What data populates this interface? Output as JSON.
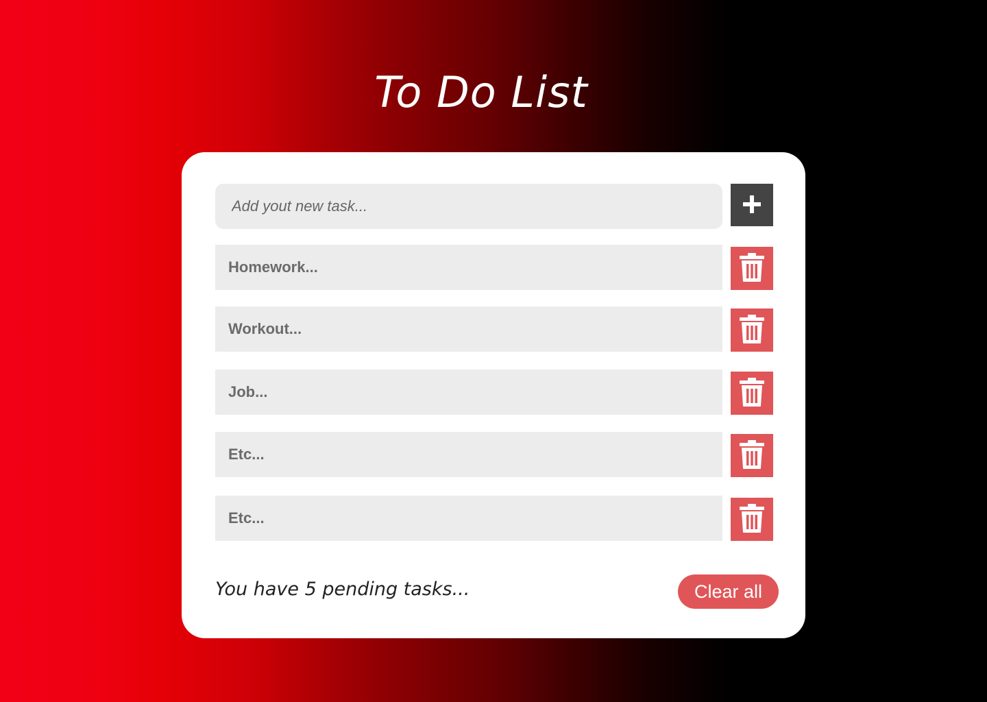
{
  "title": "To Do List",
  "input": {
    "placeholder": "Add yout new task...",
    "add_icon": "plus-icon"
  },
  "tasks": [
    {
      "label": "Homework...",
      "delete_icon": "trash-icon"
    },
    {
      "label": "Workout...",
      "delete_icon": "trash-icon"
    },
    {
      "label": "Job...",
      "delete_icon": "trash-icon"
    },
    {
      "label": "Etc...",
      "delete_icon": "trash-icon"
    },
    {
      "label": "Etc...",
      "delete_icon": "trash-icon"
    }
  ],
  "footer": {
    "pending_text": "You have 5 pending tasks...",
    "clear_label": "Clear all"
  },
  "colors": {
    "background_start": "#f20016",
    "background_end": "#000000",
    "card": "#ffffff",
    "field": "#ececec",
    "add_button": "#444444",
    "delete_button": "#e05558",
    "clear_button": "#e05558"
  }
}
